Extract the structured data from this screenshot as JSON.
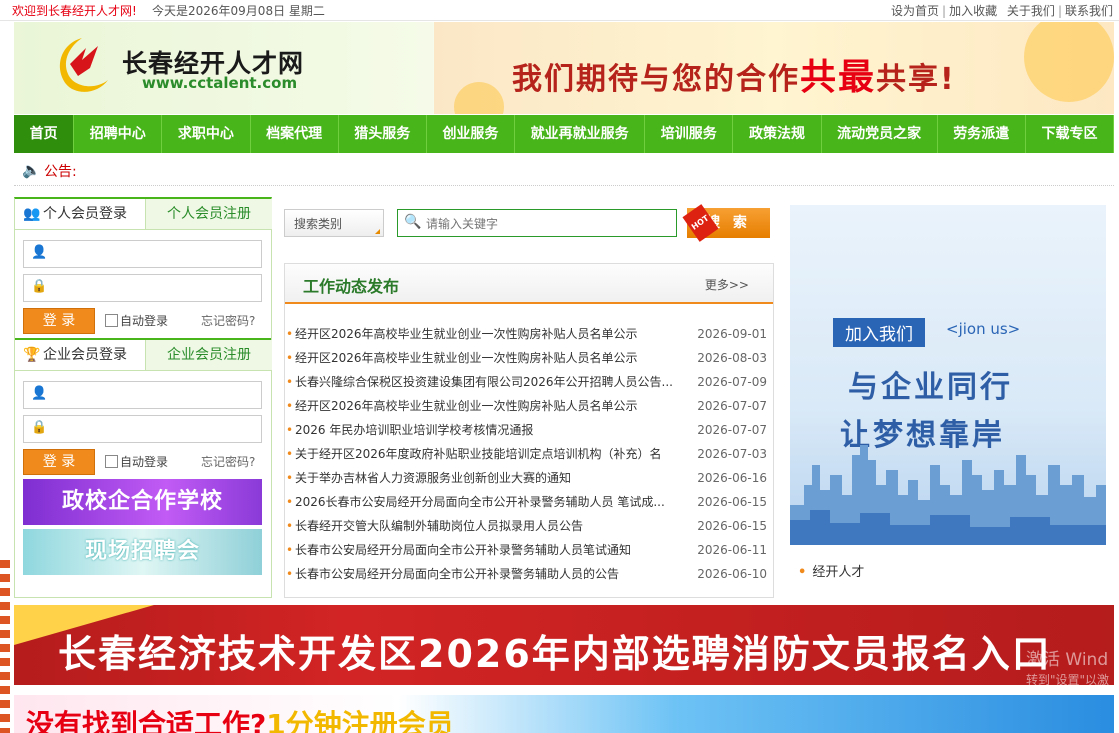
{
  "topbar": {
    "welcome": "欢迎到长春经开人才网!",
    "date": "今天是2026年09月08日 星期二",
    "links": [
      "设为首页",
      "加入收藏",
      "关于我们",
      "联系我们"
    ]
  },
  "header": {
    "site_name": "长春经开人才网",
    "site_url": "www.cctalent.com",
    "banner_pre": "我们期待与您的合作",
    "banner_gong": "共",
    "banner_zui": "最",
    "banner_post": "共享!"
  },
  "nav": {
    "items": [
      "首页",
      "招聘中心",
      "求职中心",
      "档案代理",
      "猎头服务",
      "创业服务",
      "就业再就业服务",
      "培训服务",
      "政策法规",
      "流动党员之家",
      "劳务派遣",
      "下载专区"
    ],
    "active": 0
  },
  "notice": {
    "label": "公告:"
  },
  "personal": {
    "login_tab": "个人会员登录",
    "register_tab": "个人会员注册",
    "login_button": "登 录",
    "auto_login": "自动登录",
    "forgot": "忘记密码?"
  },
  "enterprise": {
    "login_tab": "企业会员登录",
    "register_tab": "企业会员注册",
    "login_button": "登 录",
    "auto_login": "自动登录",
    "forgot": "忘记密码?"
  },
  "promos": [
    "政校企合作学校",
    "现场招聘会"
  ],
  "search": {
    "category": "搜索类别",
    "placeholder": "请输入关键字",
    "button": "搜 索",
    "hot": "HOT"
  },
  "news": {
    "title": "工作动态发布",
    "more": "更多>>",
    "items": [
      {
        "title": "经开区2026年高校毕业生就业创业一次性购房补贴人员名单公示",
        "date": "2026-09-01"
      },
      {
        "title": "经开区2026年高校毕业生就业创业一次性购房补贴人员名单公示",
        "date": "2026-08-03"
      },
      {
        "title": "长春兴隆综合保税区投资建设集团有限公司2026年公开招聘人员公告...",
        "date": "2026-07-09"
      },
      {
        "title": "经开区2026年高校毕业生就业创业一次性购房补贴人员名单公示",
        "date": "2026-07-07"
      },
      {
        "title": "2026 年民办培训职业培训学校考核情况通报",
        "date": "2026-07-07"
      },
      {
        "title": "关于经开区2026年度政府补贴职业技能培训定点培训机构（补充）名",
        "date": "2026-07-03"
      },
      {
        "title": "关于举办吉林省人力资源服务业创新创业大赛的通知",
        "date": "2026-06-16"
      },
      {
        "title": "2026长春市公安局经开分局面向全市公开补录警务辅助人员 笔试成...",
        "date": "2026-06-15"
      },
      {
        "title": "长春经开交管大队编制外辅助岗位人员拟录用人员公告",
        "date": "2026-06-15"
      },
      {
        "title": "长春市公安局经开分局面向全市公开补录警务辅助人员笔试通知",
        "date": "2026-06-11"
      },
      {
        "title": "长春市公安局经开分局面向全市公开补录警务辅助人员的公告",
        "date": "2026-06-10"
      }
    ]
  },
  "right_ad": {
    "join": "加入我们",
    "join_en": "<jion us>",
    "line1": "与企业同行",
    "line2": "让梦想靠岸",
    "caption": "经开人才"
  },
  "big_banner": "长春经济技术开发区2026年内部选聘消防文员报名入口",
  "activate": {
    "line1": "激活 Wind",
    "line2": "转到\"设置\"以激"
  },
  "bottom_banner": {
    "pre": "没有找到合适工作?",
    "post": "1分钟注册会员"
  }
}
